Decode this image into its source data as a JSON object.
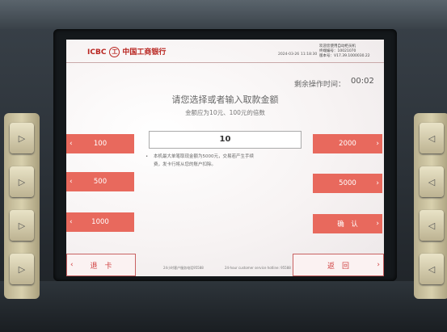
{
  "header": {
    "bank_abbr": "ICBC",
    "logo_mark": "工",
    "bank_name": "中国工商银行",
    "date": "2024-03-26",
    "time": "11:18:30",
    "welcome": "欢迎您使用自动柜员机",
    "terminal_label": "终端编号：",
    "terminal_id": "10021070",
    "version_label": "版本号：",
    "version": "V17.39.1000030.22"
  },
  "countdown": {
    "label": "剩余操作时间：",
    "value": "00:02"
  },
  "prompt": "请您选择或者输入取款金额",
  "hint": "金额应为10元、100元的倍数",
  "amount_input": {
    "value": "10"
  },
  "notice": {
    "bullet": "•",
    "line1": "本机最大单笔取现金额为5000元，交易若产生手续",
    "line2": "费，发卡行将从您的账户扣除。"
  },
  "left_buttons": [
    {
      "label": "100"
    },
    {
      "label": "500"
    },
    {
      "label": "1000"
    }
  ],
  "right_buttons": [
    {
      "label": "2000"
    },
    {
      "label": "5000"
    },
    {
      "label": "确　认"
    }
  ],
  "bottom": {
    "return_card": "退　卡",
    "back": "返　回",
    "hotline_cn": "24小时客户服务电话95588",
    "hotline_en": "24-hour customer service hotline: 95588"
  },
  "glyphs": {
    "arrow_left": "‹",
    "arrow_right": "›"
  },
  "colors": {
    "button": "#e8695d",
    "brand": "#b8241f"
  }
}
